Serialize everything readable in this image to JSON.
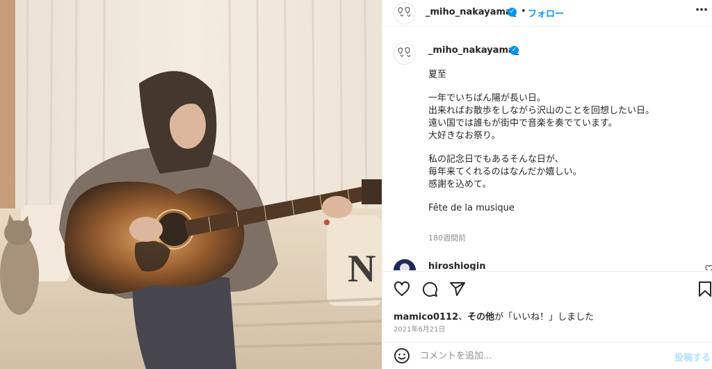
{
  "header": {
    "username": "_miho_nakayama_",
    "verified_icon": "verified-badge-icon",
    "separator": "•",
    "follow_label": "フォロー",
    "more_icon": "more-options-icon"
  },
  "caption": {
    "username": "_miho_nakayama_",
    "lines": [
      "夏至",
      "",
      "一年でいちばん陽が長い日。",
      "出来ればお散歩をしながら沢山のことを回想したい日。",
      "遠い国では誰もが街中で音楽を奏でています。",
      "大好きなお祭り。",
      "",
      "私の記念日でもあるそんな日が、",
      "毎年来てくれるのはなんだか嬉しい。",
      "感謝を込めて。",
      "",
      "Fête de la musique"
    ],
    "time": "180週間前"
  },
  "comment": {
    "username": "hiroshiogin"
  },
  "actions": {
    "like_icon": "heart-icon",
    "comment_icon": "comment-icon",
    "share_icon": "share-icon",
    "save_icon": "bookmark-icon"
  },
  "likes": {
    "user": "mamico0112",
    "separator": "、",
    "others": "その他",
    "suffix": "が「いいね！」しました"
  },
  "date": "2021年6月21日",
  "add_comment": {
    "emoji_icon": "emoji-icon",
    "placeholder": "コメントを追加...",
    "post_label": "投稿する"
  },
  "colors": {
    "accent": "#0095f6",
    "text": "#262626",
    "muted": "#8e8e8e",
    "post_disabled": "#b2dffc"
  }
}
